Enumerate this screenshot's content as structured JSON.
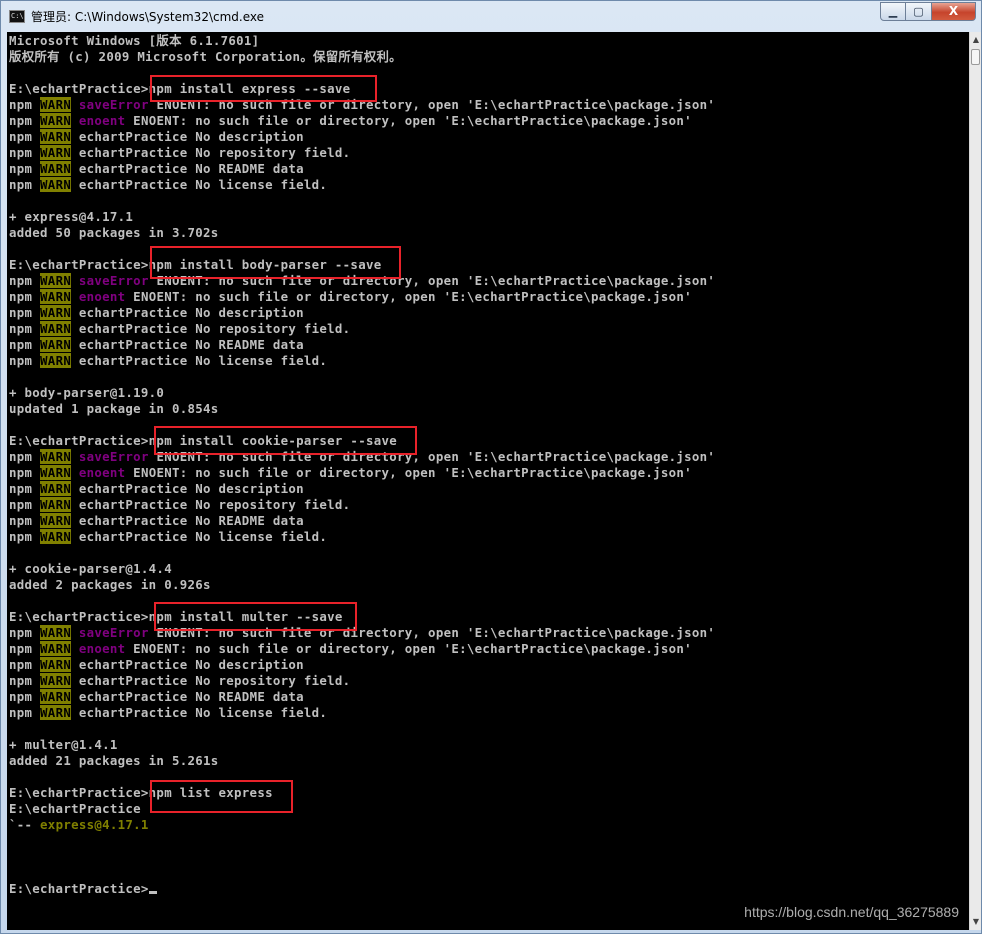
{
  "window": {
    "title": "管理员: C:\\Windows\\System32\\cmd.exe",
    "icon": "cmd-icon",
    "buttons": {
      "minimize": "▁",
      "maximize": "▢",
      "close": "X"
    }
  },
  "colors": {
    "console_bg": "#000000",
    "console_text": "#c0c0c0",
    "warn_bg": "#808000",
    "error_text": "#800080",
    "highlight_box": "#e8222a"
  },
  "console": {
    "lines": [
      [
        {
          "t": "Microsoft Windows [版本 6.1.7601]"
        }
      ],
      [
        {
          "t": "版权所有 (c) 2009 Microsoft Corporation。保留所有权利。"
        }
      ],
      [
        {
          "t": ""
        }
      ],
      [
        {
          "t": "E:\\echartPractice>npm install express --save"
        }
      ],
      [
        {
          "t": "npm "
        },
        {
          "t": "WARN",
          "s": "warn"
        },
        {
          "t": " "
        },
        {
          "t": "saveError",
          "s": "err"
        },
        {
          "t": " ENOENT: no such file or directory, open 'E:\\echartPractice\\package.json'"
        }
      ],
      [
        {
          "t": "npm "
        },
        {
          "t": "WARN",
          "s": "warn"
        },
        {
          "t": " "
        },
        {
          "t": "enoent",
          "s": "err"
        },
        {
          "t": " ENOENT: no such file or directory, open 'E:\\echartPractice\\package.json'"
        }
      ],
      [
        {
          "t": "npm "
        },
        {
          "t": "WARN",
          "s": "warn"
        },
        {
          "t": " echartPractice No description"
        }
      ],
      [
        {
          "t": "npm "
        },
        {
          "t": "WARN",
          "s": "warn"
        },
        {
          "t": " echartPractice No repository field."
        }
      ],
      [
        {
          "t": "npm "
        },
        {
          "t": "WARN",
          "s": "warn"
        },
        {
          "t": " echartPractice No README data"
        }
      ],
      [
        {
          "t": "npm "
        },
        {
          "t": "WARN",
          "s": "warn"
        },
        {
          "t": " echartPractice No license field."
        }
      ],
      [
        {
          "t": ""
        }
      ],
      [
        {
          "t": "+ express@4.17.1"
        }
      ],
      [
        {
          "t": "added 50 packages in 3.702s"
        }
      ],
      [
        {
          "t": ""
        }
      ],
      [
        {
          "t": "E:\\echartPractice>npm install body-parser --save"
        }
      ],
      [
        {
          "t": "npm "
        },
        {
          "t": "WARN",
          "s": "warn"
        },
        {
          "t": " "
        },
        {
          "t": "saveError",
          "s": "err"
        },
        {
          "t": " ENOENT: no such file or directory, open 'E:\\echartPractice\\package.json'"
        }
      ],
      [
        {
          "t": "npm "
        },
        {
          "t": "WARN",
          "s": "warn"
        },
        {
          "t": " "
        },
        {
          "t": "enoent",
          "s": "err"
        },
        {
          "t": " ENOENT: no such file or directory, open 'E:\\echartPractice\\package.json'"
        }
      ],
      [
        {
          "t": "npm "
        },
        {
          "t": "WARN",
          "s": "warn"
        },
        {
          "t": " echartPractice No description"
        }
      ],
      [
        {
          "t": "npm "
        },
        {
          "t": "WARN",
          "s": "warn"
        },
        {
          "t": " echartPractice No repository field."
        }
      ],
      [
        {
          "t": "npm "
        },
        {
          "t": "WARN",
          "s": "warn"
        },
        {
          "t": " echartPractice No README data"
        }
      ],
      [
        {
          "t": "npm "
        },
        {
          "t": "WARN",
          "s": "warn"
        },
        {
          "t": " echartPractice No license field."
        }
      ],
      [
        {
          "t": ""
        }
      ],
      [
        {
          "t": "+ body-parser@1.19.0"
        }
      ],
      [
        {
          "t": "updated 1 package in 0.854s"
        }
      ],
      [
        {
          "t": ""
        }
      ],
      [
        {
          "t": "E:\\echartPractice>npm install cookie-parser --save"
        }
      ],
      [
        {
          "t": "npm "
        },
        {
          "t": "WARN",
          "s": "warn"
        },
        {
          "t": " "
        },
        {
          "t": "saveError",
          "s": "err"
        },
        {
          "t": " ENOENT: no such file or directory, open 'E:\\echartPractice\\package.json'"
        }
      ],
      [
        {
          "t": "npm "
        },
        {
          "t": "WARN",
          "s": "warn"
        },
        {
          "t": " "
        },
        {
          "t": "enoent",
          "s": "err"
        },
        {
          "t": " ENOENT: no such file or directory, open 'E:\\echartPractice\\package.json'"
        }
      ],
      [
        {
          "t": "npm "
        },
        {
          "t": "WARN",
          "s": "warn"
        },
        {
          "t": " echartPractice No description"
        }
      ],
      [
        {
          "t": "npm "
        },
        {
          "t": "WARN",
          "s": "warn"
        },
        {
          "t": " echartPractice No repository field."
        }
      ],
      [
        {
          "t": "npm "
        },
        {
          "t": "WARN",
          "s": "warn"
        },
        {
          "t": " echartPractice No README data"
        }
      ],
      [
        {
          "t": "npm "
        },
        {
          "t": "WARN",
          "s": "warn"
        },
        {
          "t": " echartPractice No license field."
        }
      ],
      [
        {
          "t": ""
        }
      ],
      [
        {
          "t": "+ cookie-parser@1.4.4"
        }
      ],
      [
        {
          "t": "added 2 packages in 0.926s"
        }
      ],
      [
        {
          "t": ""
        }
      ],
      [
        {
          "t": "E:\\echartPractice>npm install multer --save"
        }
      ],
      [
        {
          "t": "npm "
        },
        {
          "t": "WARN",
          "s": "warn"
        },
        {
          "t": " "
        },
        {
          "t": "saveError",
          "s": "err"
        },
        {
          "t": " ENOENT: no such file or directory, open 'E:\\echartPractice\\package.json'"
        }
      ],
      [
        {
          "t": "npm "
        },
        {
          "t": "WARN",
          "s": "warn"
        },
        {
          "t": " "
        },
        {
          "t": "enoent",
          "s": "err"
        },
        {
          "t": " ENOENT: no such file or directory, open 'E:\\echartPractice\\package.json'"
        }
      ],
      [
        {
          "t": "npm "
        },
        {
          "t": "WARN",
          "s": "warn"
        },
        {
          "t": " echartPractice No description"
        }
      ],
      [
        {
          "t": "npm "
        },
        {
          "t": "WARN",
          "s": "warn"
        },
        {
          "t": " echartPractice No repository field."
        }
      ],
      [
        {
          "t": "npm "
        },
        {
          "t": "WARN",
          "s": "warn"
        },
        {
          "t": " echartPractice No README data"
        }
      ],
      [
        {
          "t": "npm "
        },
        {
          "t": "WARN",
          "s": "warn"
        },
        {
          "t": " echartPractice No license field."
        }
      ],
      [
        {
          "t": ""
        }
      ],
      [
        {
          "t": "+ multer@1.4.1"
        }
      ],
      [
        {
          "t": "added 21 packages in 5.261s"
        }
      ],
      [
        {
          "t": ""
        }
      ],
      [
        {
          "t": "E:\\echartPractice>npm list express"
        }
      ],
      [
        {
          "t": "E:\\echartPractice"
        }
      ],
      [
        {
          "t": "`-- "
        },
        {
          "t": "express@4.17.1",
          "s": "tree"
        }
      ],
      [
        {
          "t": ""
        }
      ],
      [
        {
          "t": ""
        }
      ],
      [
        {
          "t": ""
        }
      ],
      [
        {
          "t": "E:\\echartPractice>"
        },
        {
          "t": "",
          "s": "cursor"
        }
      ]
    ]
  },
  "watermark": "https://blog.csdn.net/qq_36275889"
}
